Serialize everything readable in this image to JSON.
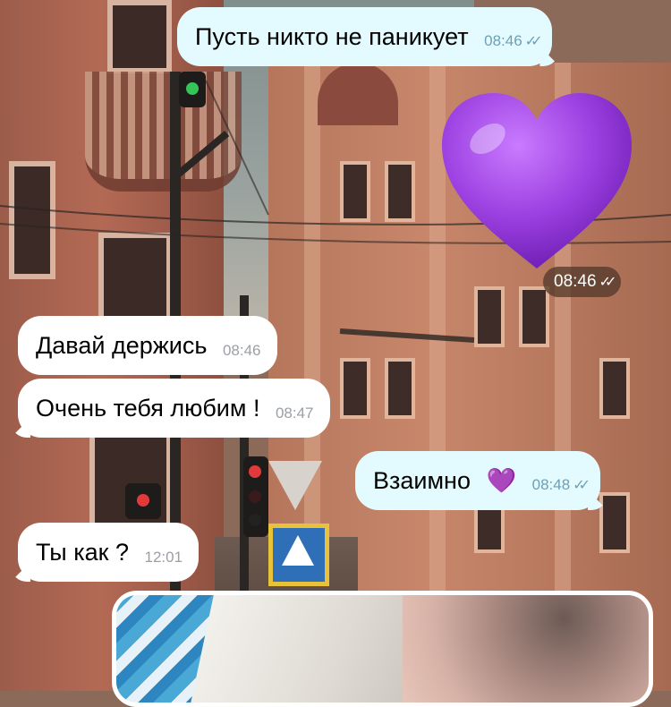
{
  "messages": [
    {
      "id": "m1",
      "dir": "out",
      "text": "Пусть никто не паникует",
      "time": "08:46",
      "status": "read"
    },
    {
      "id": "m2",
      "dir": "out",
      "type": "emoji-sticker",
      "emoji": "purple-heart",
      "time": "08:46",
      "status": "read"
    },
    {
      "id": "m3",
      "dir": "in",
      "text": "Давай держись",
      "time": "08:46"
    },
    {
      "id": "m4",
      "dir": "in",
      "text": "Очень тебя любим !",
      "time": "08:47"
    },
    {
      "id": "m5",
      "dir": "out",
      "text": "Взаимно",
      "emoji": "💜",
      "time": "08:48",
      "status": "read"
    },
    {
      "id": "m6",
      "dir": "in",
      "text": "Ты как ?",
      "time": "12:01"
    },
    {
      "id": "m7",
      "dir": "in",
      "type": "photo"
    }
  ],
  "check_glyph": "✓✓",
  "colors": {
    "outgoing_bubble": "#e3fbfe",
    "incoming_bubble": "#ffffff",
    "heart": "#9b3fe0",
    "read_check": "#6f9fb4"
  }
}
